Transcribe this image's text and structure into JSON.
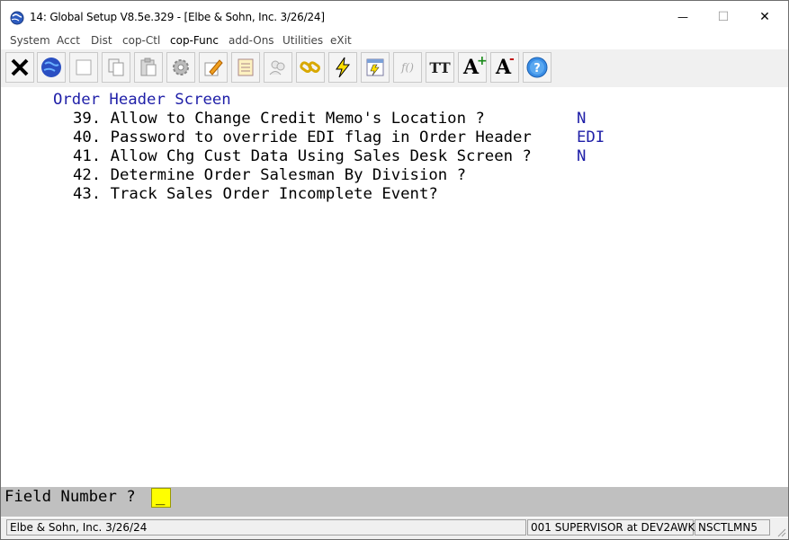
{
  "window": {
    "title": "14: Global Setup V8.5e.329 - [Elbe & Sohn, Inc. 3/26/24]",
    "minimize_glyph": "—",
    "maximize_glyph": "☐",
    "close_glyph": "✕"
  },
  "menu": {
    "items": [
      "System",
      "Acct",
      "Dist",
      "cop-Ctl",
      "cop-Func",
      "add-Ons",
      "Utilities",
      "eXit"
    ]
  },
  "toolbar": {
    "buttons": [
      "close-icon",
      "globe-icon",
      "blank-icon",
      "copy-icon",
      "paste-icon",
      "settings-icon",
      "edit-icon",
      "notepad-icon",
      "users-icon",
      "link-icon",
      "lightning-icon",
      "calculator-icon",
      "function-icon",
      "font-icon",
      "font-increase-icon",
      "font-decrease-icon",
      "help-icon"
    ],
    "function_label": "f()",
    "font_label": "TT",
    "font_increase_label": "A",
    "font_decrease_label": "A"
  },
  "screen": {
    "heading": "Order Header Screen",
    "fields": [
      {
        "label": "39. Allow to Change Credit Memo's Location ?",
        "value": "N"
      },
      {
        "label": "40. Password to override EDI flag in Order Header",
        "value": "EDI"
      },
      {
        "label": "41. Allow Chg Cust Data Using Sales Desk Screen ?",
        "value": "N"
      },
      {
        "label": "42. Determine Order Salesman By Division ?",
        "value": ""
      },
      {
        "label": "43. Track Sales Order Incomplete Event?",
        "value": ""
      }
    ]
  },
  "prompt": {
    "label": "Field Number ?",
    "value": "_"
  },
  "status": {
    "company": "Elbe & Sohn, Inc. 3/26/24",
    "user": "001 SUPERVISOR at DEV2AWK",
    "code": "NSCTLMN5"
  },
  "colors": {
    "value_text": "#1f1fa8",
    "prompt_background": "#c0c0c0",
    "cursor_highlight": "#ffff00"
  }
}
